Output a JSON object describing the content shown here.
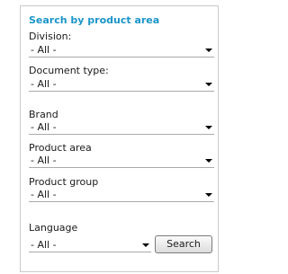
{
  "search_panel": {
    "heading": "Search by product area",
    "fields": [
      {
        "label": "Division:",
        "value": "- All -"
      },
      {
        "label": "Document type:",
        "value": "- All -"
      },
      {
        "label": "Brand",
        "value": "- All -"
      },
      {
        "label": "Product area",
        "value": "- All -"
      },
      {
        "label": "Product group",
        "value": "- All -"
      },
      {
        "label": "Language",
        "value": "- All -"
      }
    ],
    "search_button": "Search"
  }
}
